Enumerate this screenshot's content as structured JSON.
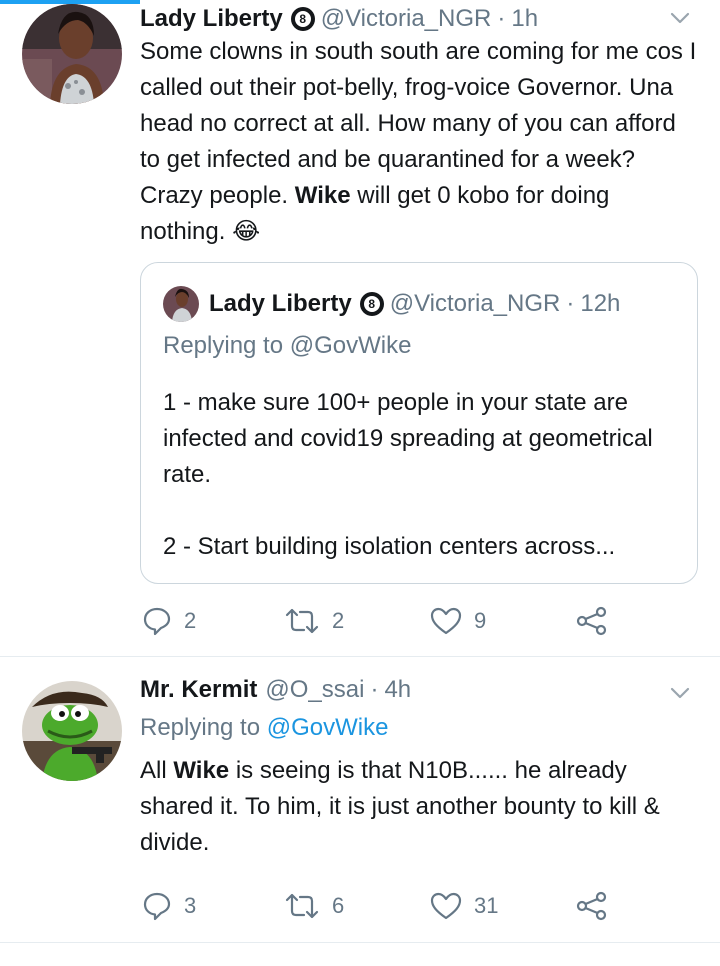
{
  "tweets": [
    {
      "display_name": "Lady Liberty",
      "badge": "8",
      "handle": "@Victoria_NGR",
      "separator": "·",
      "time": "1h",
      "text_parts": [
        "Some clowns in south south are coming for me cos I called out their pot-belly, frog-voice Governor. Una head no correct at all. How many of you can afford to get infected and be quarantined for a week? Crazy people. ",
        "Wike",
        " will get 0 kobo for doing nothing. ",
        "😂"
      ],
      "quote": {
        "display_name": "Lady Liberty",
        "badge": "8",
        "handle": "@Victoria_NGR",
        "separator": "·",
        "time": "12h",
        "reply_prefix": "Replying to",
        "reply_mention": "@GovWike",
        "line1": "1 - make sure 100+ people in your state are infected and covid19 spreading at geometrical rate.",
        "line2": "2 - Start building isolation centers across..."
      },
      "actions": {
        "replies": "2",
        "retweets": "2",
        "likes": "9"
      }
    },
    {
      "display_name": "Mr. Kermit",
      "handle": "@O_ssai",
      "separator": "·",
      "time": "4h",
      "reply_prefix": "Replying to",
      "reply_mention": "@GovWike",
      "text_parts": [
        "All ",
        "Wike",
        " is seeing is that N10B...... he already shared it. To him, it is just another bounty to kill & divide."
      ],
      "actions": {
        "replies": "3",
        "retweets": "6",
        "likes": "31"
      }
    }
  ],
  "colors": {
    "accent": "#1da1f2",
    "link": "#1b95e0",
    "secondary_text": "#657786",
    "border": "#ccd6dd"
  },
  "icons": [
    "chevron-down-icon",
    "reply-icon",
    "retweet-icon",
    "like-icon",
    "share-icon",
    "verified-badge-icon"
  ]
}
